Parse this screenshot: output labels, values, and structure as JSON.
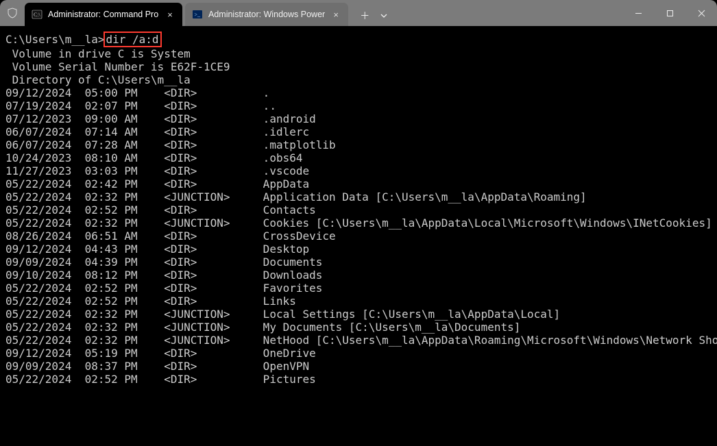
{
  "titlebar": {
    "tabs": [
      {
        "label": "Administrator: Command Pro",
        "type": "cmd",
        "active": true
      },
      {
        "label": "Administrator: Windows Power",
        "type": "ps",
        "active": false
      }
    ]
  },
  "terminal": {
    "prompt_path": "C:\\Users\\m__la>",
    "command": "dir /a:d",
    "header_lines": [
      " Volume in drive C is System",
      " Volume Serial Number is E62F-1CE9",
      "",
      " Directory of C:\\Users\\m__la",
      ""
    ],
    "entries": [
      {
        "date": "09/12/2024",
        "time": "05:00 PM",
        "type": "<DIR>",
        "name": "."
      },
      {
        "date": "07/19/2024",
        "time": "02:07 PM",
        "type": "<DIR>",
        "name": ".."
      },
      {
        "date": "07/12/2023",
        "time": "09:00 AM",
        "type": "<DIR>",
        "name": ".android"
      },
      {
        "date": "06/07/2024",
        "time": "07:14 AM",
        "type": "<DIR>",
        "name": ".idlerc"
      },
      {
        "date": "06/07/2024",
        "time": "07:28 AM",
        "type": "<DIR>",
        "name": ".matplotlib"
      },
      {
        "date": "10/24/2023",
        "time": "08:10 AM",
        "type": "<DIR>",
        "name": ".obs64"
      },
      {
        "date": "11/27/2023",
        "time": "03:03 PM",
        "type": "<DIR>",
        "name": ".vscode"
      },
      {
        "date": "05/22/2024",
        "time": "02:42 PM",
        "type": "<DIR>",
        "name": "AppData"
      },
      {
        "date": "05/22/2024",
        "time": "02:32 PM",
        "type": "<JUNCTION>",
        "name": "Application Data [C:\\Users\\m__la\\AppData\\Roaming]"
      },
      {
        "date": "05/22/2024",
        "time": "02:52 PM",
        "type": "<DIR>",
        "name": "Contacts"
      },
      {
        "date": "05/22/2024",
        "time": "02:32 PM",
        "type": "<JUNCTION>",
        "name": "Cookies [C:\\Users\\m__la\\AppData\\Local\\Microsoft\\Windows\\INetCookies]"
      },
      {
        "date": "08/26/2024",
        "time": "06:51 AM",
        "type": "<DIR>",
        "name": "CrossDevice"
      },
      {
        "date": "09/12/2024",
        "time": "04:43 PM",
        "type": "<DIR>",
        "name": "Desktop"
      },
      {
        "date": "09/09/2024",
        "time": "04:39 PM",
        "type": "<DIR>",
        "name": "Documents"
      },
      {
        "date": "09/10/2024",
        "time": "08:12 PM",
        "type": "<DIR>",
        "name": "Downloads"
      },
      {
        "date": "05/22/2024",
        "time": "02:52 PM",
        "type": "<DIR>",
        "name": "Favorites"
      },
      {
        "date": "05/22/2024",
        "time": "02:52 PM",
        "type": "<DIR>",
        "name": "Links"
      },
      {
        "date": "05/22/2024",
        "time": "02:32 PM",
        "type": "<JUNCTION>",
        "name": "Local Settings [C:\\Users\\m__la\\AppData\\Local]"
      },
      {
        "date": "05/22/2024",
        "time": "02:32 PM",
        "type": "<JUNCTION>",
        "name": "My Documents [C:\\Users\\m__la\\Documents]"
      },
      {
        "date": "05/22/2024",
        "time": "02:32 PM",
        "type": "<JUNCTION>",
        "name": "NetHood [C:\\Users\\m__la\\AppData\\Roaming\\Microsoft\\Windows\\Network Shortcuts]"
      },
      {
        "date": "09/12/2024",
        "time": "05:19 PM",
        "type": "<DIR>",
        "name": "OneDrive"
      },
      {
        "date": "09/09/2024",
        "time": "08:37 PM",
        "type": "<DIR>",
        "name": "OpenVPN"
      },
      {
        "date": "05/22/2024",
        "time": "02:52 PM",
        "type": "<DIR>",
        "name": "Pictures"
      }
    ]
  },
  "colors": {
    "highlight_border": "#ff3b30",
    "titlebar_bg": "#7b7b7b",
    "terminal_bg": "#000000",
    "terminal_fg": "#cccccc"
  }
}
